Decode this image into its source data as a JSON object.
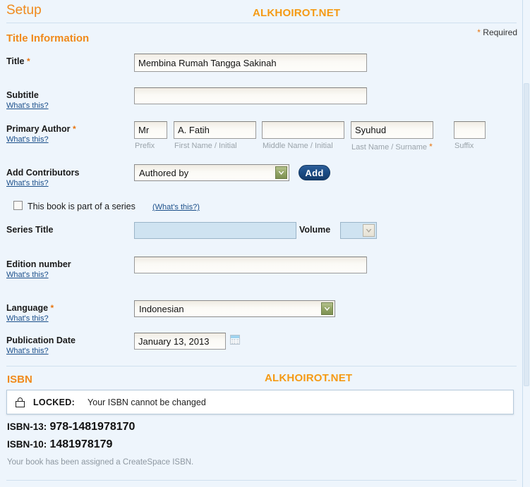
{
  "header": {
    "page_title": "Setup",
    "watermark": "ALKHOIROT.NET",
    "required_note": "Required",
    "required_star": "*"
  },
  "sections": {
    "title_information": {
      "heading": "Title Information",
      "fields": {
        "title": {
          "label": "Title",
          "required_star": "*",
          "value": "Membina Rumah Tangga Sakinah"
        },
        "subtitle": {
          "label": "Subtitle",
          "whats_this": "What's this?",
          "value": ""
        },
        "primary_author": {
          "label": "Primary Author",
          "required_star": "*",
          "whats_this": "What's this?",
          "prefix": {
            "value": "Mr",
            "sublabel": "Prefix"
          },
          "first_name": {
            "value": "A. Fatih",
            "sublabel": "First Name / Initial"
          },
          "middle_name": {
            "value": "",
            "sublabel": "Middle Name / Initial"
          },
          "last_name": {
            "value": "Syuhud",
            "sublabel": "Last Name / Surname",
            "required_star": "*"
          },
          "suffix": {
            "value": "",
            "sublabel": "Suffix"
          }
        },
        "add_contributors": {
          "label": "Add Contributors",
          "whats_this": "What's this?",
          "selected": "Authored by",
          "add_button": "Add"
        },
        "series_checkbox": {
          "label": "This book is part of a series",
          "whats_this": "(What's this?)",
          "checked": false
        },
        "series_title": {
          "label": "Series Title",
          "value": "",
          "disabled": true
        },
        "volume": {
          "label": "Volume",
          "selected": "",
          "disabled": true
        },
        "edition_number": {
          "label": "Edition number",
          "whats_this": "What's this?",
          "value": ""
        },
        "language": {
          "label": "Language",
          "required_star": "*",
          "whats_this": "What's this?",
          "selected": "Indonesian"
        },
        "publication_date": {
          "label": "Publication Date",
          "whats_this": "What's this?",
          "value": "January 13, 2013"
        }
      }
    },
    "isbn": {
      "heading": "ISBN",
      "watermark": "ALKHOIROT.NET",
      "locked_label": "LOCKED:",
      "locked_message": "Your ISBN cannot be changed",
      "isbn13_key": "ISBN-13:",
      "isbn13_value": "978-1481978170",
      "isbn10_key": "ISBN-10:",
      "isbn10_value": "1481978179",
      "note": "Your book has been assigned a CreateSpace ISBN."
    }
  },
  "colors": {
    "page_bg": "#eef5fc",
    "accent_orange": "#f08a1c",
    "watermark_orange": "#f59a14",
    "link_blue": "#1b4f8a",
    "add_button_blue": "#1b4d86",
    "disabled_field": "#cfe3f1"
  }
}
